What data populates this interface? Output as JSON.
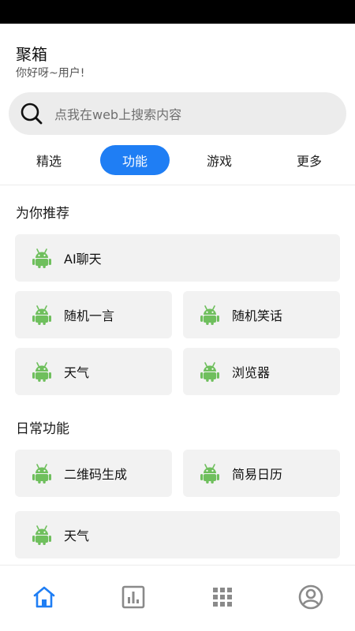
{
  "app": {
    "title": "聚箱",
    "greeting": "你好呀~用户!"
  },
  "search": {
    "placeholder": "点我在web上搜索内容",
    "icon": "search-icon"
  },
  "tabs": [
    {
      "label": "精选",
      "active": false
    },
    {
      "label": "功能",
      "active": true
    },
    {
      "label": "游戏",
      "active": false
    },
    {
      "label": "更多",
      "active": false
    }
  ],
  "sections": {
    "recommended": {
      "title": "为你推荐",
      "items": [
        {
          "label": "AI聊天",
          "icon": "android-robot-icon"
        },
        {
          "label": "随机一言",
          "icon": "android-robot-icon"
        },
        {
          "label": "随机笑话",
          "icon": "android-robot-icon"
        },
        {
          "label": "天气",
          "icon": "android-robot-icon"
        },
        {
          "label": "浏览器",
          "icon": "android-robot-icon"
        }
      ]
    },
    "daily": {
      "title": "日常功能",
      "items": [
        {
          "label": "二维码生成",
          "icon": "android-robot-icon"
        },
        {
          "label": "简易日历",
          "icon": "android-robot-icon"
        },
        {
          "label": "天气",
          "icon": "android-robot-icon"
        }
      ]
    }
  },
  "bottom_nav": [
    {
      "icon": "home-icon",
      "active": true
    },
    {
      "icon": "chart-icon",
      "active": false
    },
    {
      "icon": "apps-grid-icon",
      "active": false
    },
    {
      "icon": "profile-icon",
      "active": false
    }
  ],
  "colors": {
    "accent": "#1f7ef4",
    "card_bg": "#f2f2f2",
    "search_bg": "#ececec",
    "robot_green": "#6fbf5d",
    "nav_inactive": "#8a8a8a"
  }
}
